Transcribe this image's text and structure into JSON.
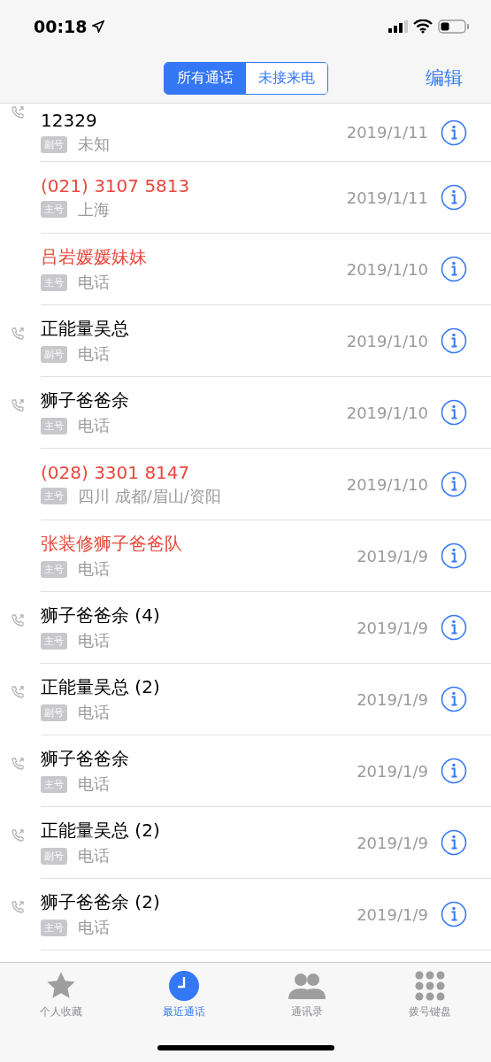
{
  "status_bar": {
    "time": "00:18"
  },
  "nav": {
    "segments": [
      {
        "label": "所有通话",
        "selected": true
      },
      {
        "label": "未接来电",
        "selected": false
      }
    ],
    "edit": "编辑"
  },
  "calls": [
    {
      "name": "12329",
      "missed": false,
      "outgoing": true,
      "sim": "副号",
      "label": "未知",
      "date": "2019/1/11"
    },
    {
      "name": "(021) 3107 5813",
      "missed": true,
      "outgoing": false,
      "sim": "主号",
      "label": "上海",
      "date": "2019/1/11"
    },
    {
      "name": "吕岩媛媛妹妹",
      "missed": true,
      "outgoing": false,
      "sim": "主号",
      "label": "电话",
      "date": "2019/1/10"
    },
    {
      "name": "正能量吴总",
      "missed": false,
      "outgoing": true,
      "sim": "副号",
      "label": "电话",
      "date": "2019/1/10"
    },
    {
      "name": "狮子爸爸余",
      "missed": false,
      "outgoing": true,
      "sim": "主号",
      "label": "电话",
      "date": "2019/1/10"
    },
    {
      "name": "(028) 3301 8147",
      "missed": true,
      "outgoing": false,
      "sim": "主号",
      "label": "四川 成都/眉山/资阳",
      "date": "2019/1/10"
    },
    {
      "name": "张装修狮子爸爸队",
      "missed": true,
      "outgoing": false,
      "sim": "主号",
      "label": "电话",
      "date": "2019/1/9"
    },
    {
      "name": "狮子爸爸余 (4)",
      "missed": false,
      "outgoing": true,
      "sim": "主号",
      "label": "电话",
      "date": "2019/1/9"
    },
    {
      "name": "正能量吴总 (2)",
      "missed": false,
      "outgoing": true,
      "sim": "副号",
      "label": "电话",
      "date": "2019/1/9"
    },
    {
      "name": "狮子爸爸余",
      "missed": false,
      "outgoing": true,
      "sim": "主号",
      "label": "电话",
      "date": "2019/1/9"
    },
    {
      "name": "正能量吴总 (2)",
      "missed": false,
      "outgoing": true,
      "sim": "副号",
      "label": "电话",
      "date": "2019/1/9"
    },
    {
      "name": "狮子爸爸余 (2)",
      "missed": false,
      "outgoing": true,
      "sim": "主号",
      "label": "电话",
      "date": "2019/1/9"
    }
  ],
  "tab_bar": [
    {
      "kind": "favorites",
      "label": "个人收藏",
      "selected": false
    },
    {
      "kind": "recents",
      "label": "最近通话",
      "selected": true
    },
    {
      "kind": "contacts",
      "label": "通讯录",
      "selected": false
    },
    {
      "kind": "keypad",
      "label": "拨号键盘",
      "selected": false
    }
  ]
}
